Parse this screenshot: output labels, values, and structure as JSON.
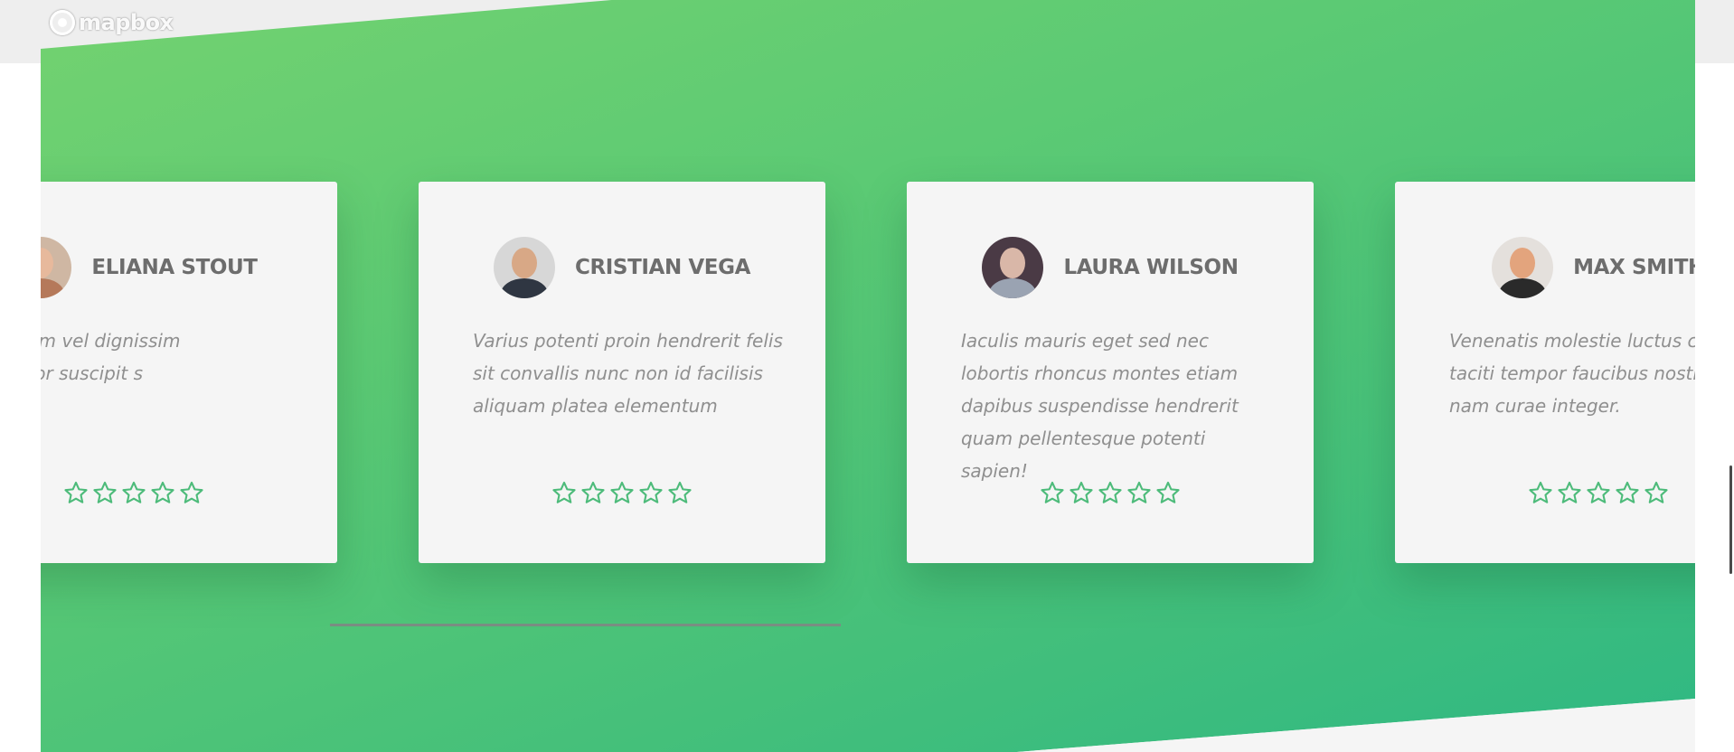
{
  "map": {
    "logo_text": "mapbox",
    "logo_icon": "mapbox-logo-icon"
  },
  "colors": {
    "gradient_start": "#73d270",
    "gradient_end": "#2fb883",
    "card_background": "#f5f5f5",
    "star_outline": "#4dbb7a",
    "name_text": "#6d6d6d",
    "quote_text": "#8f8f8f"
  },
  "testimonials": [
    {
      "name": "ELIANA STOUT",
      "quote": "ugiat sed lorem vel dignissim habitasse dolor suscipit s dapibus",
      "rating": 0,
      "star_icon": "star-outline-icon"
    },
    {
      "name": "CRISTIAN VEGA",
      "quote": "Varius potenti proin hendrerit felis sit convallis nunc non id facilisis aliquam platea elementum",
      "rating": 0,
      "star_icon": "star-outline-icon"
    },
    {
      "name": "LAURA WILSON",
      "quote": "Iaculis mauris eget sed nec lobortis rhoncus montes etiam dapibus suspendisse hendrerit quam pellentesque potenti sapien!",
      "rating": 0,
      "star_icon": "star-outline-icon"
    },
    {
      "name": "MAX SMITH",
      "quote": "Venenatis molestie luctus cubilia taciti tempor faucibus nostra nam curae integer.",
      "rating": 0,
      "star_icon": "star-outline-icon"
    }
  ],
  "carousel": {
    "progress": 0.25
  }
}
